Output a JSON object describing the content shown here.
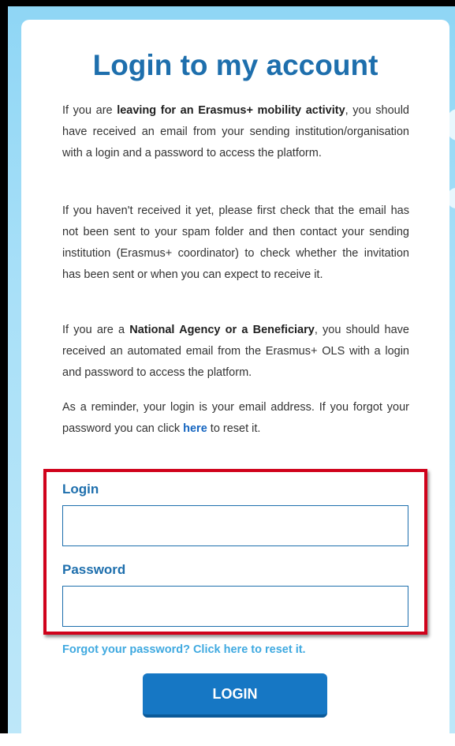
{
  "page": {
    "title": "Login to my account"
  },
  "intro": {
    "p1": {
      "pre": "If you are ",
      "bold": "leaving for an Erasmus+ mobility activity",
      "post": ", you should have received an email from your sending institution/organisation with a login and a password to access the platform."
    },
    "p2": "If you haven't received it yet, please first check that the email has not been sent to your spam folder and then contact your sending institution (Erasmus+ coordinator) to check whether the invitation has been sent or when you can expect to receive it.",
    "p3": {
      "pre": "If you are a ",
      "bold": "National Agency or a Beneficiary",
      "post": ", you should have received an automated email from the Erasmus+ OLS with a login and password to access the platform."
    },
    "p4": {
      "pre": "As a reminder, your login is your email address. If you forgot your password you can click ",
      "link": "here",
      "post": " to reset it."
    }
  },
  "form": {
    "login_label": "Login",
    "login_value": "",
    "password_label": "Password",
    "password_value": "",
    "forgot_link": "Forgot your password? Click here to reset it.",
    "submit_label": "LOGIN"
  },
  "colors": {
    "accent": "#1e6fad",
    "button": "#1677c4",
    "highlight_border": "#d0021b",
    "link_light": "#3fa9e0",
    "background": "#a9e0f8"
  }
}
